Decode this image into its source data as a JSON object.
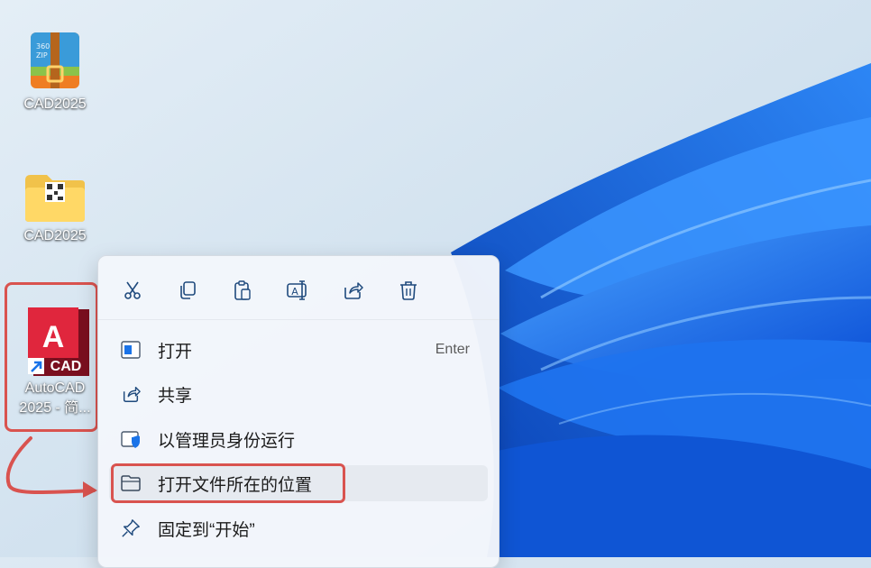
{
  "desktop": {
    "icons": [
      {
        "label": "CAD2025",
        "icon": "360zip-archive-icon"
      },
      {
        "label": "CAD2025",
        "icon": "folder-icon"
      },
      {
        "label_line1": "AutoCAD",
        "label_line2": "2025 - 简...",
        "badge": "CAD",
        "icon_letter": "A",
        "icon": "autocad-shortcut-icon"
      }
    ]
  },
  "context_menu": {
    "toolbar": [
      {
        "name": "cut",
        "icon": "scissors-icon"
      },
      {
        "name": "copy",
        "icon": "copy-icon"
      },
      {
        "name": "paste",
        "icon": "clipboard-icon"
      },
      {
        "name": "rename",
        "icon": "rename-icon"
      },
      {
        "name": "share",
        "icon": "share-icon"
      },
      {
        "name": "delete",
        "icon": "trash-icon"
      }
    ],
    "items": [
      {
        "label": "打开",
        "shortcut": "Enter",
        "icon": "app-window-icon"
      },
      {
        "label": "共享",
        "icon": "share-icon"
      },
      {
        "label": "以管理员身份运行",
        "icon": "admin-shield-icon"
      },
      {
        "label": "打开文件所在的位置",
        "icon": "folder-open-icon"
      },
      {
        "label": "固定到“开始”",
        "icon": "pin-icon"
      }
    ]
  },
  "colors": {
    "annotation_red": "#d9534f",
    "autocad_red": "#c8102e",
    "wallpaper_blue": "#1565e6"
  }
}
